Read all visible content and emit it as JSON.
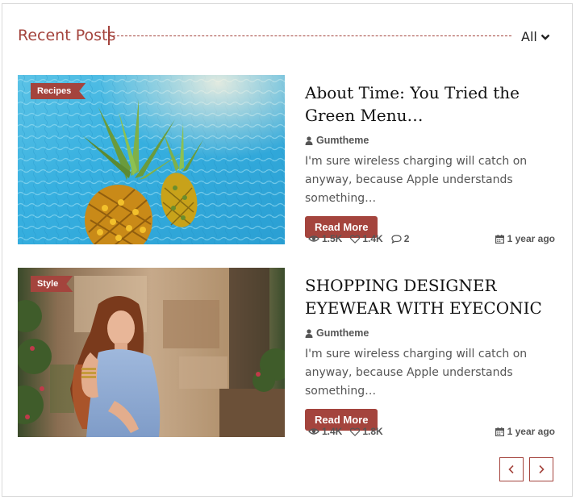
{
  "widget": {
    "title": "Recent Posts",
    "filter_label": "All",
    "accent_color": "#a4443d"
  },
  "posts": [
    {
      "category": "Recipes",
      "title": "About Time: You Tried the Green Menu…",
      "author": "Gumtheme",
      "excerpt": "I'm sure wireless charging will catch on anyway, because Apple understands something…",
      "button_label": "Read More",
      "views": "1.5K",
      "likes": "1.4K",
      "comments": "2",
      "date": "1 year ago",
      "image_subject": "pineapples-in-pool"
    },
    {
      "category": "Style",
      "title": "SHOPPING DESIGNER EYEWEAR WITH EYECONIC",
      "author": "Gumtheme",
      "excerpt": "I'm sure wireless charging will catch on anyway, because Apple understands something…",
      "button_label": "Read More",
      "views": "1.4K",
      "likes": "1.8K",
      "date": "1 year ago",
      "image_subject": "woman-in-blue-dress"
    }
  ],
  "pagination": {
    "prev_icon": "chevron-left-icon",
    "next_icon": "chevron-right-icon"
  }
}
